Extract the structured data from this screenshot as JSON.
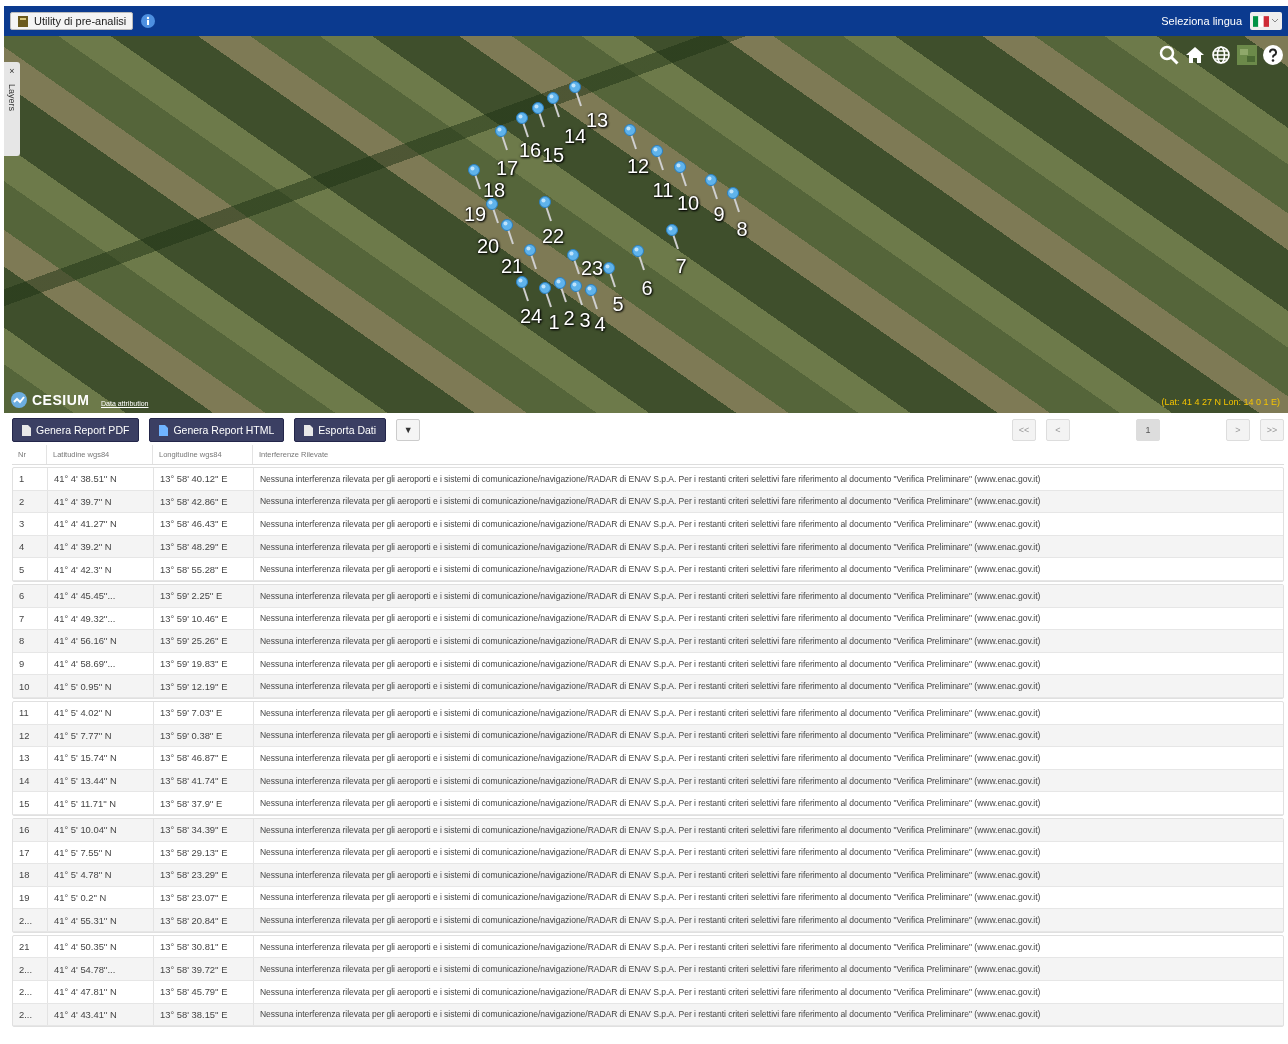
{
  "top_bar": {
    "app_button": "Utility di pre-analisi",
    "language_label": "Seleziona lingua"
  },
  "map": {
    "layers_tab": "Layers",
    "layers_close": "×",
    "logo": "CESIUM",
    "attribution": "Data attribution",
    "coordinates": "(Lat: 41 4 27 N Lon: 14 0 1 E)",
    "markers": [
      {
        "label": "1"
      },
      {
        "label": "2"
      },
      {
        "label": "3"
      },
      {
        "label": "4"
      },
      {
        "label": "5"
      },
      {
        "label": "6"
      },
      {
        "label": "7"
      },
      {
        "label": "8"
      },
      {
        "label": "9"
      },
      {
        "label": "10"
      },
      {
        "label": "11"
      },
      {
        "label": "12"
      },
      {
        "label": "13"
      },
      {
        "label": "14"
      },
      {
        "label": "15"
      },
      {
        "label": "16"
      },
      {
        "label": "17"
      },
      {
        "label": "18"
      },
      {
        "label": "19"
      },
      {
        "label": "20"
      },
      {
        "label": "21"
      },
      {
        "label": "22"
      },
      {
        "label": "23"
      },
      {
        "label": "24"
      }
    ]
  },
  "toolbar": {
    "buttons": [
      {
        "label": "Genera Report PDF",
        "kind": "pdf"
      },
      {
        "label": "Genera Report HTML",
        "kind": "html"
      },
      {
        "label": "Esporta Dati",
        "kind": "data"
      }
    ],
    "menu_caret": "▼",
    "pagination": [
      {
        "label": "<<",
        "selected": false
      },
      {
        "label": "<",
        "selected": false
      },
      {
        "label": "1",
        "selected": true
      },
      {
        "label": ">",
        "selected": false
      },
      {
        "label": ">>",
        "selected": false
      }
    ]
  },
  "table": {
    "columns": [
      "Nr",
      "Latitudine wgs84",
      "Longitudine wgs84",
      "Interferenze Rilevate"
    ],
    "rows": [
      [
        "1",
        "41° 4' 38.51'' N",
        "13° 58' 40.12'' E",
        "Nessuna interferenza rilevata per gli aeroporti e i sistemi di comunicazione/navigazione/RADAR di ENAV S.p.A. Per i restanti criteri selettivi fare riferimento al documento \"Verifica Preliminare\"  (www.enac.gov.it)"
      ],
      [
        "2",
        "41° 4' 39.7'' N",
        "13° 58' 42.86'' E",
        "Nessuna interferenza rilevata per gli aeroporti e i sistemi di comunicazione/navigazione/RADAR di ENAV S.p.A. Per i restanti criteri selettivi fare riferimento al documento \"Verifica Preliminare\"  (www.enac.gov.it)"
      ],
      [
        "3",
        "41° 4' 41.27'' N",
        "13° 58' 46.43'' E",
        "Nessuna interferenza rilevata per gli aeroporti e i sistemi di comunicazione/navigazione/RADAR di ENAV S.p.A. Per i restanti criteri selettivi fare riferimento al documento \"Verifica Preliminare\"  (www.enac.gov.it)"
      ],
      [
        "4",
        "41° 4' 39.2'' N",
        "13° 58' 48.29'' E",
        "Nessuna interferenza rilevata per gli aeroporti e i sistemi di comunicazione/navigazione/RADAR di ENAV S.p.A. Per i restanti criteri selettivi fare riferimento al documento \"Verifica Preliminare\"  (www.enac.gov.it)"
      ],
      [
        "5",
        "41° 4' 42.3'' N",
        "13° 58' 55.28'' E",
        "Nessuna interferenza rilevata per gli aeroporti e i sistemi di comunicazione/navigazione/RADAR di ENAV S.p.A. Per i restanti criteri selettivi fare riferimento al documento \"Verifica Preliminare\"  (www.enac.gov.it)"
      ],
      [
        "6",
        "41° 4' 45.45''...",
        "13° 59' 2.25'' E",
        "Nessuna interferenza rilevata per gli aeroporti e i sistemi di comunicazione/navigazione/RADAR di ENAV S.p.A. Per i restanti criteri selettivi fare riferimento al documento \"Verifica Preliminare\"  (www.enac.gov.it)"
      ],
      [
        "7",
        "41° 4' 49.32''...",
        "13° 59' 10.46'' E",
        "Nessuna interferenza rilevata per gli aeroporti e i sistemi di comunicazione/navigazione/RADAR di ENAV S.p.A. Per i restanti criteri selettivi fare riferimento al documento \"Verifica Preliminare\"  (www.enac.gov.it)"
      ],
      [
        "8",
        "41° 4' 56.16'' N",
        "13° 59' 25.26'' E",
        "Nessuna interferenza rilevata per gli aeroporti e i sistemi di comunicazione/navigazione/RADAR di ENAV S.p.A. Per i restanti criteri selettivi fare riferimento al documento \"Verifica Preliminare\"  (www.enac.gov.it)"
      ],
      [
        "9",
        "41° 4' 58.69''...",
        "13° 59' 19.83'' E",
        "Nessuna interferenza rilevata per gli aeroporti e i sistemi di comunicazione/navigazione/RADAR di ENAV S.p.A. Per i restanti criteri selettivi fare riferimento al documento \"Verifica Preliminare\"  (www.enac.gov.it)"
      ],
      [
        "10",
        "41° 5' 0.95'' N",
        "13° 59' 12.19'' E",
        "Nessuna interferenza rilevata per gli aeroporti e i sistemi di comunicazione/navigazione/RADAR di ENAV S.p.A. Per i restanti criteri selettivi fare riferimento al documento \"Verifica Preliminare\"  (www.enac.gov.it)"
      ],
      [
        "11",
        "41° 5' 4.02'' N",
        "13° 59' 7.03'' E",
        "Nessuna interferenza rilevata per gli aeroporti e i sistemi di comunicazione/navigazione/RADAR di ENAV S.p.A. Per i restanti criteri selettivi fare riferimento al documento \"Verifica Preliminare\"  (www.enac.gov.it)"
      ],
      [
        "12",
        "41° 5' 7.77'' N",
        "13° 59' 0.38'' E",
        "Nessuna interferenza rilevata per gli aeroporti e i sistemi di comunicazione/navigazione/RADAR di ENAV S.p.A. Per i restanti criteri selettivi fare riferimento al documento \"Verifica Preliminare\"  (www.enac.gov.it)"
      ],
      [
        "13",
        "41° 5' 15.74'' N",
        "13° 58' 46.87'' E",
        "Nessuna interferenza rilevata per gli aeroporti e i sistemi di comunicazione/navigazione/RADAR di ENAV S.p.A. Per i restanti criteri selettivi fare riferimento al documento \"Verifica Preliminare\"  (www.enac.gov.it)"
      ],
      [
        "14",
        "41° 5' 13.44'' N",
        "13° 58' 41.74'' E",
        "Nessuna interferenza rilevata per gli aeroporti e i sistemi di comunicazione/navigazione/RADAR di ENAV S.p.A. Per i restanti criteri selettivi fare riferimento al documento \"Verifica Preliminare\"  (www.enac.gov.it)"
      ],
      [
        "15",
        "41° 5' 11.71'' N",
        "13° 58' 37.9'' E",
        "Nessuna interferenza rilevata per gli aeroporti e i sistemi di comunicazione/navigazione/RADAR di ENAV S.p.A. Per i restanti criteri selettivi fare riferimento al documento \"Verifica Preliminare\"  (www.enac.gov.it)"
      ],
      [
        "16",
        "41° 5' 10.04'' N",
        "13° 58' 34.39'' E",
        "Nessuna interferenza rilevata per gli aeroporti e i sistemi di comunicazione/navigazione/RADAR di ENAV S.p.A. Per i restanti criteri selettivi fare riferimento al documento \"Verifica Preliminare\"  (www.enac.gov.it)"
      ],
      [
        "17",
        "41° 5' 7.55'' N",
        "13° 58' 29.13'' E",
        "Nessuna interferenza rilevata per gli aeroporti e i sistemi di comunicazione/navigazione/RADAR di ENAV S.p.A. Per i restanti criteri selettivi fare riferimento al documento \"Verifica Preliminare\"  (www.enac.gov.it)"
      ],
      [
        "18",
        "41° 5' 4.78'' N",
        "13° 58' 23.29'' E",
        "Nessuna interferenza rilevata per gli aeroporti e i sistemi di comunicazione/navigazione/RADAR di ENAV S.p.A. Per i restanti criteri selettivi fare riferimento al documento \"Verifica Preliminare\"  (www.enac.gov.it)"
      ],
      [
        "19",
        "41° 5' 0.2'' N",
        "13° 58' 23.07'' E",
        "Nessuna interferenza rilevata per gli aeroporti e i sistemi di comunicazione/navigazione/RADAR di ENAV S.p.A. Per i restanti criteri selettivi fare riferimento al documento \"Verifica Preliminare\"  (www.enac.gov.it)"
      ],
      [
        "2...",
        "41° 4' 55.31'' N",
        "13° 58' 20.84'' E",
        "Nessuna interferenza rilevata per gli aeroporti e i sistemi di comunicazione/navigazione/RADAR di ENAV S.p.A. Per i restanti criteri selettivi fare riferimento al documento \"Verifica Preliminare\"  (www.enac.gov.it)"
      ],
      [
        "21",
        "41° 4' 50.35'' N",
        "13° 58' 30.81'' E",
        "Nessuna interferenza rilevata per gli aeroporti e i sistemi di comunicazione/navigazione/RADAR di ENAV S.p.A. Per i restanti criteri selettivi fare riferimento al documento \"Verifica Preliminare\"  (www.enac.gov.it)"
      ],
      [
        "2...",
        "41° 4' 54.78''...",
        "13° 58' 39.72'' E",
        "Nessuna interferenza rilevata per gli aeroporti e i sistemi di comunicazione/navigazione/RADAR di ENAV S.p.A. Per i restanti criteri selettivi fare riferimento al documento \"Verifica Preliminare\"  (www.enac.gov.it)"
      ],
      [
        "2...",
        "41° 4' 47.81'' N",
        "13° 58' 45.79'' E",
        "Nessuna interferenza rilevata per gli aeroporti e i sistemi di comunicazione/navigazione/RADAR di ENAV S.p.A. Per i restanti criteri selettivi fare riferimento al documento \"Verifica Preliminare\"  (www.enac.gov.it)"
      ],
      [
        "2...",
        "41° 4' 43.41'' N",
        "13° 58' 38.15'' E",
        "Nessuna interferenza rilevata per gli aeroporti e i sistemi di comunicazione/navigazione/RADAR di ENAV S.p.A. Per i restanti criteri selettivi fare riferimento al documento \"Verifica Preliminare\"  (www.enac.gov.it)"
      ]
    ]
  }
}
